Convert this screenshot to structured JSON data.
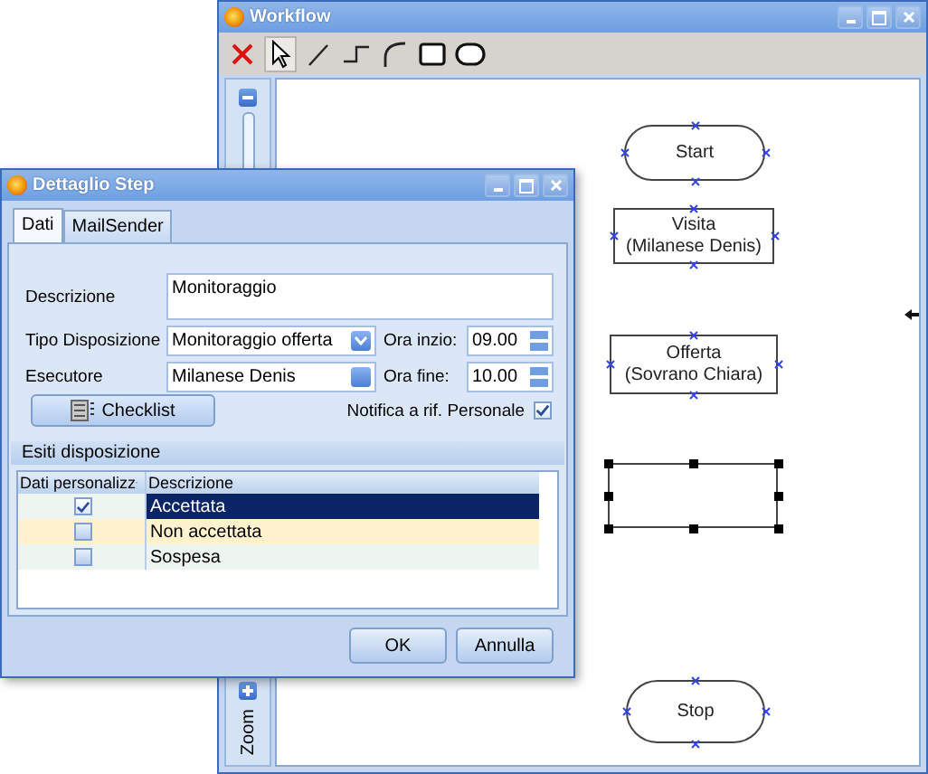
{
  "workflow_window": {
    "title": "Workflow",
    "toolbar": [
      {
        "kind": "delete",
        "selected": false
      },
      {
        "kind": "pointer",
        "selected": true
      },
      {
        "kind": "line",
        "selected": false
      },
      {
        "kind": "step",
        "selected": false
      },
      {
        "kind": "arc",
        "selected": false
      },
      {
        "kind": "rectangle",
        "selected": false
      },
      {
        "kind": "rounded",
        "selected": false
      }
    ],
    "zoom_label": "Zoom",
    "nodes": [
      {
        "kind": "terminal",
        "label": "Start",
        "selected": false
      },
      {
        "kind": "process",
        "label": "Visita\n(Milanese Denis)",
        "selected": false
      },
      {
        "kind": "process",
        "label": "Offerta\n(Sovrano Chiara)",
        "selected": false
      },
      {
        "kind": "process",
        "selected": true
      },
      {
        "kind": "terminal",
        "label": "Stop",
        "selected": false
      }
    ]
  },
  "dialog": {
    "title": "Dettaglio Step",
    "tabs": [
      {
        "label": "Dati",
        "selected": true
      },
      {
        "label": "MailSender",
        "selected": false
      }
    ],
    "descrizione": {
      "label": "Descrizione",
      "value": "Monitoraggio"
    },
    "tipo_disposizione": {
      "label": "Tipo Disposizione",
      "value": "Monitoraggio offerta"
    },
    "esecutore": {
      "label": "Esecutore",
      "value": "Milanese Denis"
    },
    "ora_inizio": {
      "label": "Ora inzio:",
      "value": "09.00"
    },
    "ora_fine": {
      "label": "Ora fine:",
      "value": "10.00"
    },
    "checklist_button": "Checklist",
    "notifica": {
      "label": "Notifica a rif. Personale",
      "checked": true
    },
    "group_title": "Esiti disposizione",
    "grid": {
      "columns": [
        "Dati personalizz",
        "Descrizione"
      ],
      "rows": [
        {
          "checked": true,
          "descrizione": "Accettata",
          "selected": true,
          "hovered": false
        },
        {
          "checked": false,
          "descrizione": "Non accettata",
          "selected": false,
          "hovered": true
        },
        {
          "checked": false,
          "descrizione": "Sospesa",
          "selected": false,
          "hovered": false
        }
      ]
    },
    "buttons": [
      "OK",
      "Annulla"
    ]
  }
}
